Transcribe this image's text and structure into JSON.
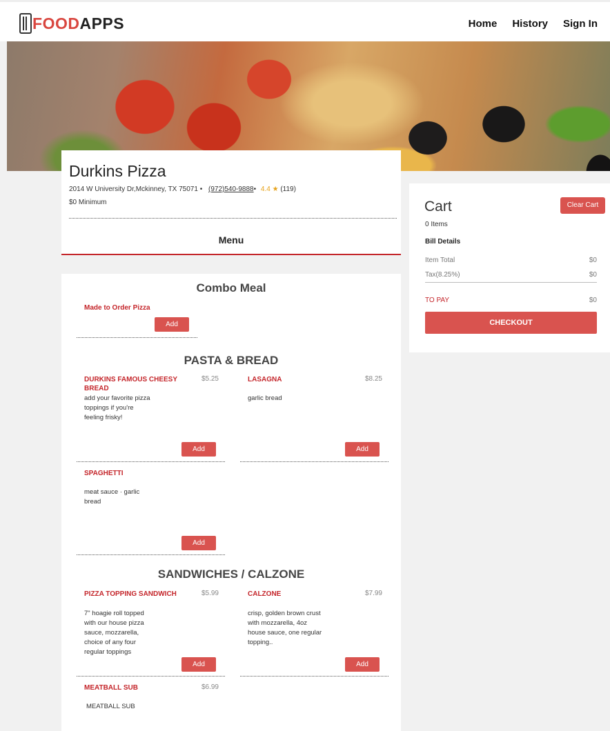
{
  "brand": {
    "logo_prefix": "F",
    "logo_accent": "OOD",
    "logo_suffix": "APPS",
    "accent_color": "#d9534f"
  },
  "nav": {
    "home": "Home",
    "history": "History",
    "sign_in": "Sign In"
  },
  "restaurant": {
    "name": "Durkins Pizza",
    "address": "2014 W University Dr,Mckinney, TX 75071 •",
    "phone": "(972)540-9888",
    "separator": "•",
    "rating": "4.4 ★",
    "reviews": "(119)",
    "minimum": "$0 Minimum",
    "menu_tab": "Menu"
  },
  "menu": {
    "combo": {
      "title": "Combo Meal",
      "items": [
        {
          "name": "Made to Order Pizza",
          "add": "Add"
        }
      ]
    },
    "pasta": {
      "title": "PASTA & BREAD",
      "items": [
        {
          "name": "DURKINS FAMOUS CHEESY BREAD",
          "price": "$5.25",
          "desc": "add your favorite pizza toppings if you're feeling frisky!",
          "add": "Add"
        },
        {
          "name": "LASAGNA",
          "price": "$8.25",
          "desc": "garlic bread",
          "add": "Add"
        },
        {
          "name": "SPAGHETTI",
          "price": "",
          "desc": "meat sauce · garlic bread",
          "add": "Add"
        }
      ]
    },
    "sandwiches": {
      "title": "SANDWICHES / CALZONE",
      "items": [
        {
          "name": "PIZZA TOPPING SANDWICH",
          "price": "$5.99",
          "desc": "7\" hoagie roll topped with our house pizza sauce, mozzarella, choice of any four regular toppings",
          "add": "Add"
        },
        {
          "name": "CALZONE",
          "price": "$7.99",
          "desc": "crisp, golden brown crust with mozzarella, 4oz house sauce, one regular topping..",
          "add": "Add"
        },
        {
          "name": "MEATBALL SUB",
          "price": "$6.99",
          "desc": "MEATBALL SUB"
        }
      ]
    }
  },
  "cart": {
    "title": "Cart",
    "clear": "Clear Cart",
    "count": "0 Items",
    "bill_title": "Bill Details",
    "item_total_label": "Item Total",
    "item_total": "$0",
    "tax_label": "Tax(8.25%)",
    "tax": "$0",
    "to_pay_label": "TO PAY",
    "to_pay": "$0",
    "checkout": "CHECKOUT"
  }
}
